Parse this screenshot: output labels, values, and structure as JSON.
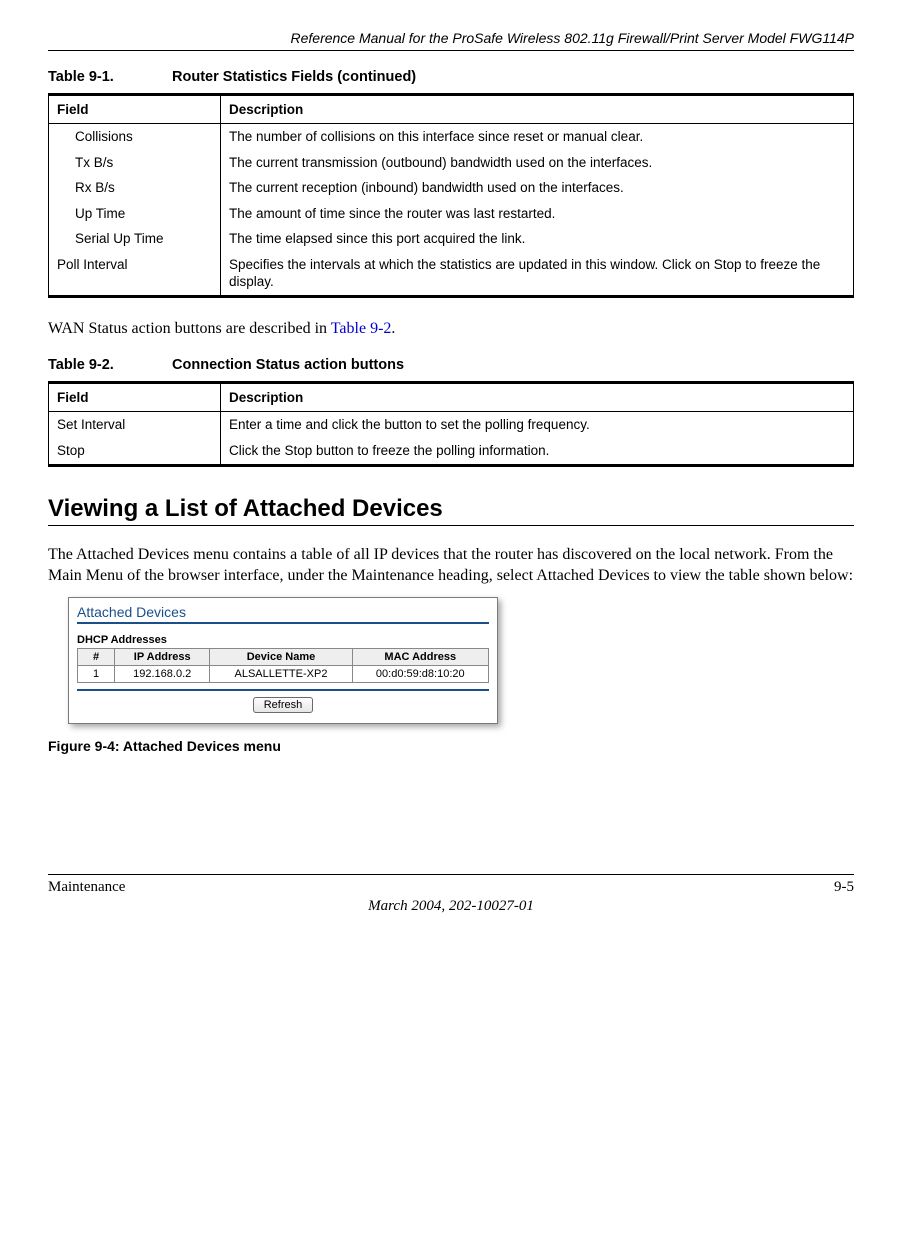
{
  "header": {
    "running": "Reference Manual for the ProSafe Wireless 802.11g  Firewall/Print Server Model FWG114P"
  },
  "table91": {
    "caption_num": "Table 9-1.",
    "caption_title": "Router Statistics Fields (continued)",
    "head_field": "Field",
    "head_desc": "Description",
    "rows": [
      {
        "field": "Collisions",
        "indent": true,
        "desc": "The number of collisions on this interface since reset or manual clear."
      },
      {
        "field": "Tx B/s",
        "indent": true,
        "desc": "The current transmission (outbound) bandwidth used on the interfaces."
      },
      {
        "field": "Rx B/s",
        "indent": true,
        "desc": "The current reception (inbound) bandwidth used on the interfaces."
      },
      {
        "field": "Up Time",
        "indent": true,
        "desc": "The amount of time since the router was last restarted."
      },
      {
        "field": "Serial Up Time",
        "indent": true,
        "desc": "The time elapsed since this port acquired the link."
      },
      {
        "field": "Poll Interval",
        "indent": false,
        "desc": "Specifies the intervals at which the statistics are updated in this window. Click on Stop to freeze the display."
      }
    ]
  },
  "para1_pre": "WAN Status action buttons are described in ",
  "para1_xref": "Table 9-2",
  "para1_post": ".",
  "table92": {
    "caption_num": "Table 9-2.",
    "caption_title": "Connection Status action buttons",
    "head_field": "Field",
    "head_desc": "Description",
    "rows": [
      {
        "field": "Set Interval",
        "desc": "Enter a time and click the button to set the polling frequency."
      },
      {
        "field": "Stop",
        "desc": "Click the Stop button to freeze the polling information."
      }
    ]
  },
  "section_heading": "Viewing a List of Attached Devices",
  "para2": "The Attached Devices menu contains a table of all IP devices that the router has discovered on the local network. From the Main Menu of the browser interface, under the Maintenance heading, select Attached Devices to view the table shown below:",
  "screenshot": {
    "title": "Attached Devices",
    "subtitle": "DHCP Addresses",
    "cols": {
      "num": "#",
      "ip": "IP Address",
      "name": "Device Name",
      "mac": "MAC Address"
    },
    "row": {
      "num": "1",
      "ip": "192.168.0.2",
      "name": "ALSALLETTE-XP2",
      "mac": "00:d0:59:d8:10:20"
    },
    "button": "Refresh"
  },
  "figure_caption": "Figure 9-4:  Attached Devices menu",
  "footer": {
    "left": "Maintenance",
    "right": "9-5",
    "date": "March 2004, 202-10027-01"
  },
  "chart_data": {
    "type": "table",
    "tables": [
      {
        "title": "Table 9-1. Router Statistics Fields (continued)",
        "columns": [
          "Field",
          "Description"
        ],
        "rows": [
          [
            "Collisions",
            "The number of collisions on this interface since reset or manual clear."
          ],
          [
            "Tx B/s",
            "The current transmission (outbound) bandwidth used on the interfaces."
          ],
          [
            "Rx B/s",
            "The current reception (inbound) bandwidth used on the interfaces."
          ],
          [
            "Up Time",
            "The amount of time since the router was last restarted."
          ],
          [
            "Serial Up Time",
            "The time elapsed since this port acquired the link."
          ],
          [
            "Poll Interval",
            "Specifies the intervals at which the statistics are updated in this window. Click on Stop to freeze the display."
          ]
        ]
      },
      {
        "title": "Table 9-2. Connection Status action buttons",
        "columns": [
          "Field",
          "Description"
        ],
        "rows": [
          [
            "Set Interval",
            "Enter a time and click the button to set the polling frequency."
          ],
          [
            "Stop",
            "Click the Stop button to freeze the polling information."
          ]
        ]
      },
      {
        "title": "Attached Devices — DHCP Addresses",
        "columns": [
          "#",
          "IP Address",
          "Device Name",
          "MAC Address"
        ],
        "rows": [
          [
            "1",
            "192.168.0.2",
            "ALSALLETTE-XP2",
            "00:d0:59:d8:10:20"
          ]
        ]
      }
    ]
  }
}
